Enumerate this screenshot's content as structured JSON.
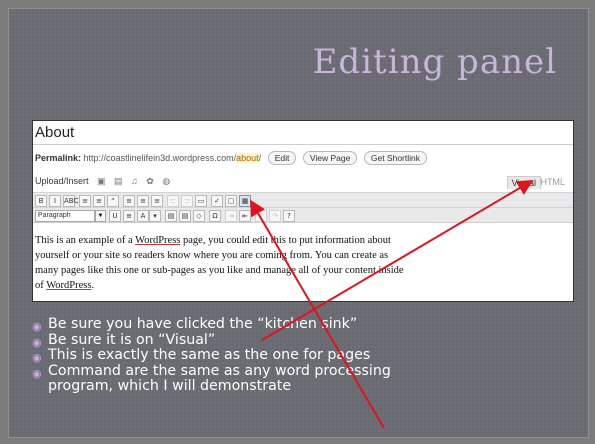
{
  "slide": {
    "title": "Editing panel"
  },
  "editor": {
    "page_title": "About",
    "permalink_label": "Permalink:",
    "permalink_url": "http://coastlinelifein3d.wordpress.com/",
    "permalink_slug": "about",
    "permalink_slash": "/",
    "edit_button": "Edit",
    "view_page_button": "View Page",
    "shortlink_button": "Get Shortlink",
    "upload_label": "Upload/Insert",
    "upload_icons": "▣ ▤ ♫ ✿ ◍",
    "tab_visual": "Visual",
    "tab_html": "HTML",
    "format_select": "Paragraph",
    "content_parts": {
      "a": "This is an example of a ",
      "wp1": "WordPress",
      "b": " page, you could edit this to put information about",
      "line2": "yourself or your site so readers know where you are coming from. You can create as",
      "line3": "many pages like this one or sub-pages as you like and manage all of your content inside",
      "c": "of ",
      "wp2": "WordPress",
      "d": "."
    }
  },
  "toolbar_row1": [
    "B",
    "I",
    "ABC",
    "≡",
    "≡",
    "“",
    "≡",
    "≡",
    "≡",
    "⊂",
    "⊃",
    "▭",
    "✓",
    "▢",
    "▦"
  ],
  "toolbar_row2": [
    "U",
    "≡",
    "A",
    "▾",
    "▤",
    "▤",
    "◇",
    "Ω",
    "⇥",
    "⇤",
    "↶",
    "↷",
    "?"
  ],
  "bullets": [
    "Be sure you have clicked the “kitchen sink”",
    "Be sure it is on “Visual”",
    "This is exactly the same as the one for pages",
    "Command are the same as any word processing",
    "program, which I will demonstrate"
  ],
  "colors": {
    "title": "#c7b6da",
    "arrow": "#e0141c",
    "bullet_dot": "#c9a9e3"
  }
}
